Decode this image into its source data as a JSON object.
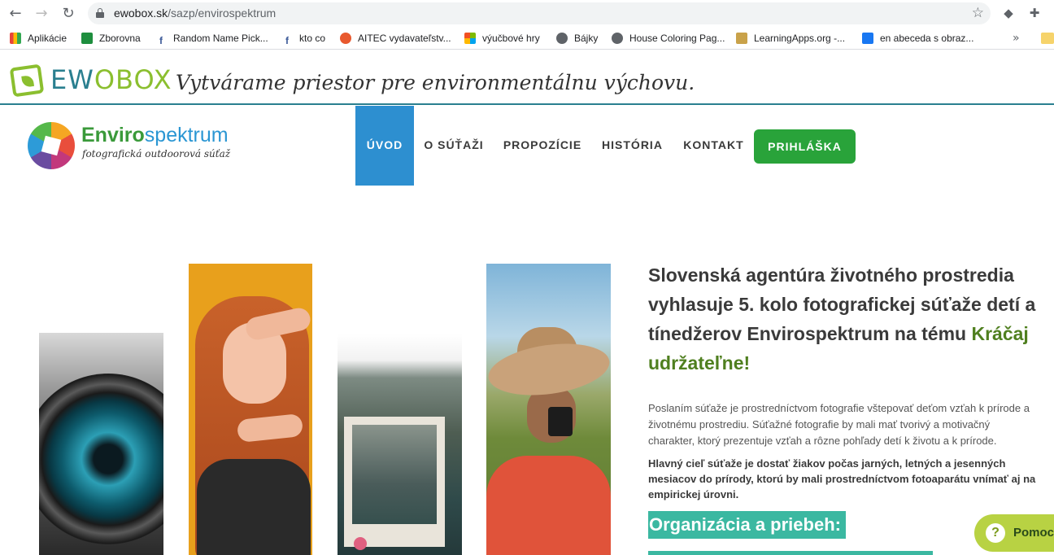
{
  "browser": {
    "url_domain": "ewobox.sk",
    "url_path": "/sazp/envirospektrum",
    "back_icon": "←",
    "forward_icon": "→",
    "reload_icon": "↻",
    "star_icon": "☆",
    "bookmarks": [
      {
        "label": "Aplikácie",
        "color": "#e8453c"
      },
      {
        "label": "Zborovna",
        "color": "#1e8e3e"
      },
      {
        "label": "Random Name Pick...",
        "color": "#3b5998"
      },
      {
        "label": "kto co",
        "color": "#3b5998"
      },
      {
        "label": "AITEC vydavateľstv...",
        "color": "#e8592e"
      },
      {
        "label": "výučbové hry",
        "color": "#f25022"
      },
      {
        "label": "Bájky",
        "color": "#5f6368"
      },
      {
        "label": "House Coloring Pag...",
        "color": "#5f6368"
      },
      {
        "label": "LearningApps.org -...",
        "color": "#c9a24a"
      },
      {
        "label": "en abeceda s obraz...",
        "color": "#1877f2"
      }
    ],
    "more_icon": "»"
  },
  "ewobox": {
    "name_prefix": "EW",
    "name_suffix": "OBOX",
    "tagline": "Vytvárame priestor pre environmentálnu výchovu."
  },
  "site": {
    "title_a": "Enviro",
    "title_b": "spektrum",
    "subtitle": "fotografická outdoorová súťaž"
  },
  "menu": [
    "ÚVOD",
    "O SÚŤAŽI",
    "PROPOZÍCIE",
    "HISTÓRIA",
    "KONTAKT"
  ],
  "signup_label": "PRIHLÁŠKA",
  "content": {
    "headline_plain": "Slovenská agentúra životného prostredia vyhlasuje 5. kolo fotografickej súťaže detí a tínedžerov Envirospektrum na tému ",
    "headline_highlight": "Kráčaj udržateľne!",
    "p1_lines": [
      "Poslaním súťaže je prostredníctvom fotografie vštepovať deťom vzťah k prírode a",
      "životnému prostrediu. Súťažné fotografie by mali mať tvorivý a motivačný",
      "charakter, ktorý prezentuje vzťah a rôzne pohľady detí k životu a k prírode."
    ],
    "p2_lines": [
      "Hlavný cieľ súťaže je dostať žiakov počas jarných, letných a jesenných",
      "mesiacov do prírody, ktorú by mali prostredníctvom fotoaparátu vnímať aj na",
      "empirickej úrovni."
    ],
    "org_heading": "Organizácia a priebeh:"
  },
  "help_label": "Pomoc"
}
